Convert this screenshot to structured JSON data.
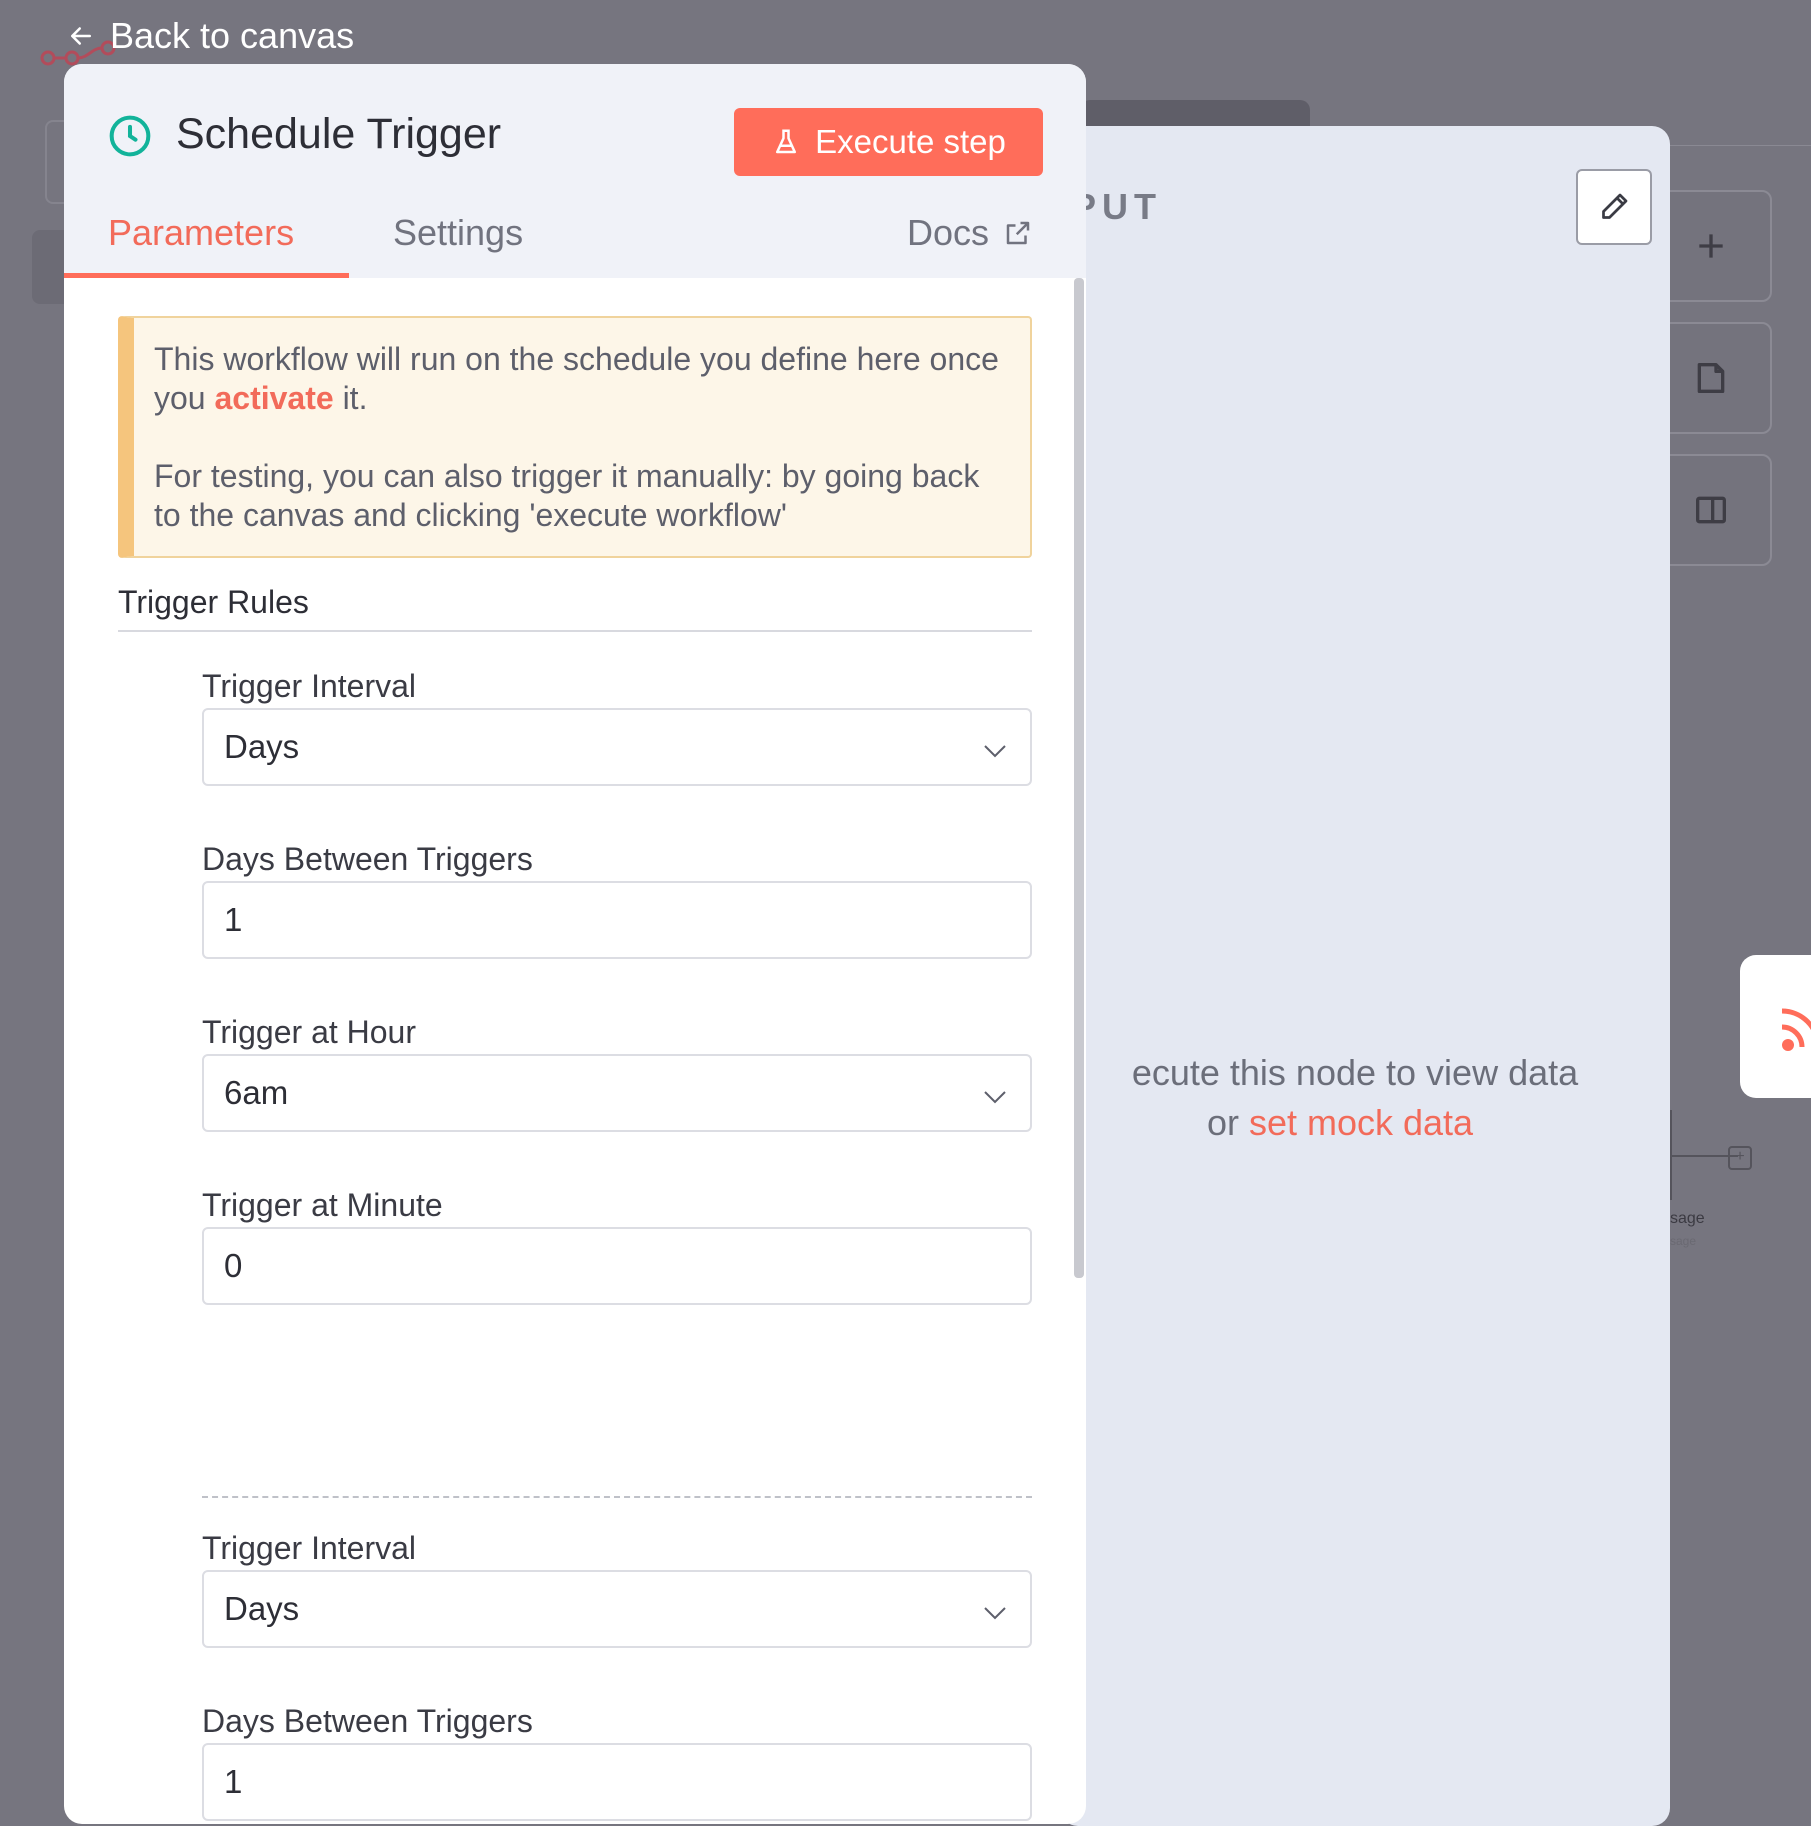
{
  "nav": {
    "back_label": "Back to canvas"
  },
  "node": {
    "title": "Schedule Trigger",
    "execute_label": "Execute step",
    "tabs": [
      "Parameters",
      "Settings"
    ],
    "docs_label": "Docs"
  },
  "notice": {
    "line1_before": "This workflow will run on the schedule you define here once you ",
    "activate_link": "activate",
    "line1_after": " it.",
    "line2": "For testing, you can also trigger it manually: by going back to the canvas and clicking 'execute workflow'"
  },
  "trigger_rules": {
    "title": "Trigger Rules",
    "rule1": {
      "interval_label": "Trigger Interval",
      "interval_value": "Days",
      "days_label": "Days Between Triggers",
      "days_value": "1",
      "hour_label": "Trigger at Hour",
      "hour_value": "6am",
      "minute_label": "Trigger at Minute",
      "minute_value": "0"
    },
    "rule2": {
      "interval_label": "Trigger Interval",
      "interval_value": "Days",
      "days_label": "Days Between Triggers",
      "days_value": "1"
    }
  },
  "input_panel": {
    "title_fragment": "PUT",
    "message_line1": "ecute this node to view data",
    "message_or": "or ",
    "mock_link": "set mock data"
  },
  "canvas": {
    "node_label": "sage",
    "node_sublabel": "sage"
  },
  "colors": {
    "accent": "#ff6d5a",
    "link": "#f26b5a",
    "trigger_icon": "#12b39a",
    "notice_bg": "#fdf6e8",
    "notice_border": "#f5c57d"
  }
}
